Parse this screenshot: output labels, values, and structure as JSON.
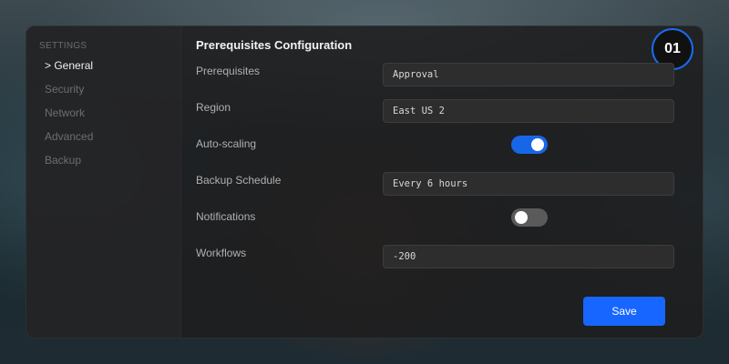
{
  "sidebar": {
    "heading": "SETTINGS",
    "items": [
      {
        "label": "> General",
        "active": true
      },
      {
        "label": "Security",
        "active": false
      },
      {
        "label": "Network",
        "active": false
      },
      {
        "label": "Advanced",
        "active": false
      },
      {
        "label": "Backup",
        "active": false
      }
    ]
  },
  "main": {
    "title": "Prerequisites Configuration",
    "step_badge": "01",
    "fields": {
      "prerequisites": {
        "label": "Prerequisites",
        "value": "Approval"
      },
      "region": {
        "label": "Region",
        "value": "East US 2"
      },
      "auto_scaling": {
        "label": "Auto-scaling",
        "enabled": true
      },
      "backup_schedule": {
        "label": "Backup Schedule",
        "value": "Every 6 hours"
      },
      "notifications": {
        "label": "Notifications",
        "enabled": false
      },
      "workflows": {
        "label": "Workflows",
        "value": "-200"
      }
    },
    "save_label": "Save"
  },
  "colors": {
    "accent": "#1766ff",
    "toggle_on": "#1766e8",
    "toggle_off": "#5a5a5a",
    "panel_bg": "#1e1e1f"
  }
}
